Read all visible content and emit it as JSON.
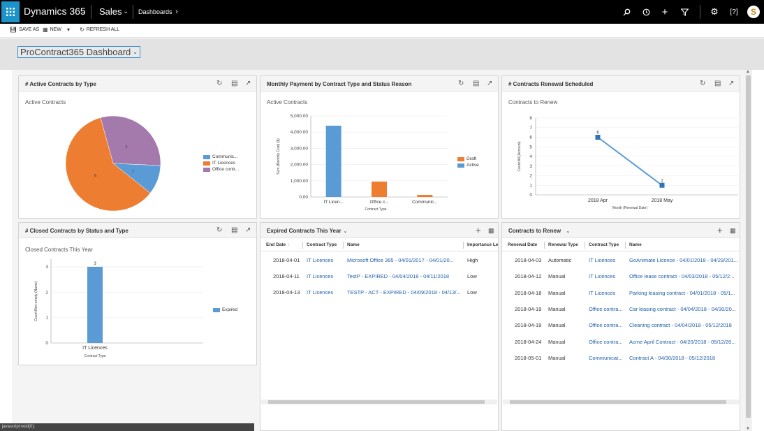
{
  "topbar": {
    "app_name": "Dynamics 365",
    "area": "Sales",
    "breadcrumb": "Dashboards",
    "avatar_initial": "S"
  },
  "cmdbar": {
    "save_as": "SAVE AS",
    "new": "NEW",
    "refresh_all": "REFRESH ALL"
  },
  "dashboard_selector": "ProContract365 Dashboard",
  "panels": {
    "active_by_type": {
      "title": "# Active Contracts by Type",
      "subtitle": "Active Contracts",
      "legend": [
        "Communic...",
        "IT Licences",
        "Office contr..."
      ]
    },
    "monthly_payment": {
      "title": "Monthly Payment by Contract Type and Status Reason",
      "subtitle": "Active Contracts",
      "legend": [
        "Draft",
        "Active"
      ]
    },
    "renewal_scheduled": {
      "title": "# Contracts Renewal Scheduled",
      "subtitle": "Contracts to Renew"
    },
    "closed_by_status": {
      "title": "# Closed Contracts by Status and Type",
      "subtitle": "Closed Contracts This Year",
      "legend": [
        "Expired"
      ]
    },
    "expired_this_year": {
      "title": "Expired Contracts This Year",
      "columns": [
        "End Date ↑",
        "Contract Type",
        "Name",
        "Importance Le"
      ],
      "rows": [
        [
          "2018-04-01",
          "IT Licences",
          "Microsoft Office 365 - 04/01/2017 - 04/01/20...",
          "High"
        ],
        [
          "2018-04-11",
          "IT Licences",
          "TestP - EXPIRED - 04/04/2018 - 04/11/2018",
          "Low"
        ],
        [
          "2018-04-13",
          "IT Licences",
          "TESTP - ACT - EXPIRED - 04/09/2018 - 04/13/...",
          "Low"
        ]
      ]
    },
    "contracts_to_renew": {
      "title": "Contracts to Renew",
      "columns": [
        "Renewal Date",
        "Renewal Type",
        "Contract Type",
        "Name"
      ],
      "rows": [
        [
          "2018-04-03",
          "Automatic",
          "IT Licences",
          "GoAnimate Licence - 04/01/2018 - 04/29/201..."
        ],
        [
          "2018-04-12",
          "Manual",
          "IT Licences",
          "Office lease contract - 04/03/2018 - 05/12/2..."
        ],
        [
          "2018-04-18",
          "Manual",
          "IT Licences",
          "Parking leasing contract - 04/01/2018 - 05/1..."
        ],
        [
          "2018-04-19",
          "Manual",
          "Office contra...",
          "Car leasing contract - 04/04/2018 - 04/30/20..."
        ],
        [
          "2018-04-19",
          "Manual",
          "Office contra...",
          "Cleaning contract - 04/04/2018 - 05/12/2018"
        ],
        [
          "2018-04-24",
          "Manual",
          "Office contra...",
          "Acme April Contract - 04/20/2018 - 05/12/20..."
        ],
        [
          "2018-05-01",
          "Manual",
          "Communicat...",
          "Contract A - 04/30/2018 - 05/12/2018"
        ]
      ]
    }
  },
  "status_bar": "javascript:void(0);",
  "colors": {
    "blue": "#5b9bd5",
    "orange": "#ed7d31",
    "purple": "#a47aad",
    "line": "#5b9bd5",
    "marker": "#2e75b6",
    "link": "#1f5fa8"
  },
  "chart_data": [
    {
      "type": "pie",
      "title": "Active Contracts",
      "categories": [
        "Communic...",
        "IT Licences",
        "Office contr..."
      ],
      "values": [
        1,
        6,
        3
      ],
      "data_labels": [
        "1",
        "6",
        "3"
      ]
    },
    {
      "type": "bar",
      "title": "Active Contracts",
      "categories": [
        "IT Licen...",
        "Office c...",
        "Communic..."
      ],
      "series": [
        {
          "name": "Draft",
          "values": [
            0,
            950,
            130
          ]
        },
        {
          "name": "Active",
          "values": [
            4400,
            0,
            0
          ]
        }
      ],
      "ylabel": "Sum (Monthly Cost) ($)",
      "xlabel": "Contract Type",
      "ylim": [
        0,
        5000
      ],
      "yticks": [
        "0.00",
        "1,000.00",
        "2,000.00",
        "3,000.00",
        "4,000.00",
        "5,000.00"
      ]
    },
    {
      "type": "line",
      "title": "Contracts to Renew",
      "categories": [
        "2018 Apr",
        "2018 May"
      ],
      "series": [
        {
          "values": [
            6,
            1
          ]
        }
      ],
      "data_labels": [
        "6",
        "1"
      ],
      "ylabel": "Count:All (Account)",
      "xlabel": "Month (Renewal Date)",
      "ylim": [
        0,
        8
      ],
      "yticks": [
        "0",
        "1",
        "2",
        "3",
        "4",
        "5",
        "6",
        "7",
        "8"
      ]
    },
    {
      "type": "bar",
      "title": "Closed Contracts This Year",
      "categories": [
        "IT Licences"
      ],
      "series": [
        {
          "name": "Expired",
          "values": [
            3
          ]
        }
      ],
      "data_labels": [
        "3"
      ],
      "ylabel": "Count:Non-empty (Name)",
      "xlabel": "Contract Type",
      "ylim": [
        0,
        3.3
      ],
      "yticks": [
        "0",
        "1",
        "2",
        "3"
      ]
    }
  ]
}
